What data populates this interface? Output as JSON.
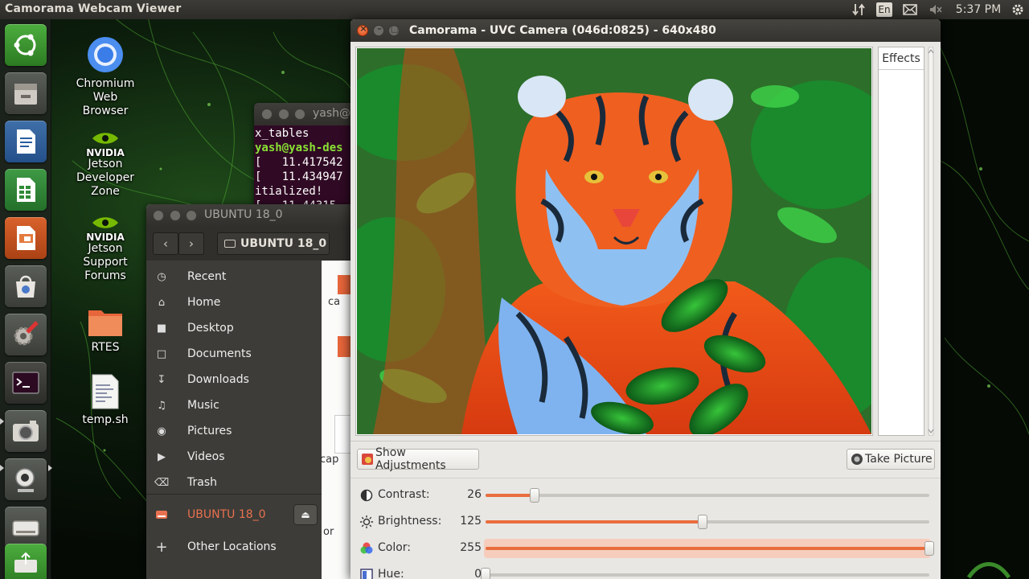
{
  "top_panel": {
    "app_title": "Camorama Webcam Viewer",
    "keyboard_layout": "En",
    "clock": "5:37 PM"
  },
  "launcher": {
    "items": [
      "ubuntu-icon",
      "file-manager-icon",
      "writer-icon",
      "calc-icon",
      "impress-icon",
      "software-center-icon",
      "settings-icon",
      "terminal-icon",
      "camera-icon",
      "webcam-icon",
      "drive-icon",
      "usb-drive-icon"
    ]
  },
  "desktop": {
    "icons": [
      {
        "label": "Chromium\nWeb\nBrowser"
      },
      {
        "label": "Jetson\nDeveloper\nZone",
        "logo": "NVIDIA"
      },
      {
        "label": "Jetson\nSupport\nForums",
        "logo": "NVIDIA"
      },
      {
        "label": "RTES"
      },
      {
        "label": "temp.sh"
      }
    ]
  },
  "terminal": {
    "title": "yash@",
    "lines": [
      "x_tables",
      "yash@yash-des",
      "[   11.417542",
      "[   11.434947",
      "itialized!",
      "[   11.44315"
    ]
  },
  "files": {
    "title": "UBUNTU 18_0",
    "location": "UBUNTU 18_0",
    "sidebar": [
      {
        "label": "Recent",
        "icon": "clock-icon"
      },
      {
        "label": "Home",
        "icon": "home-icon"
      },
      {
        "label": "Desktop",
        "icon": "folder-icon"
      },
      {
        "label": "Documents",
        "icon": "document-icon"
      },
      {
        "label": "Downloads",
        "icon": "download-icon"
      },
      {
        "label": "Music",
        "icon": "music-icon"
      },
      {
        "label": "Pictures",
        "icon": "camera-icon"
      },
      {
        "label": "Videos",
        "icon": "video-icon"
      },
      {
        "label": "Trash",
        "icon": "trash-icon"
      }
    ],
    "mounted": {
      "label": "UBUNTU 18_0",
      "color": "#e9714f"
    },
    "other": {
      "label": "Other Locations"
    },
    "partial_labels": [
      "ca",
      "cap",
      "or"
    ]
  },
  "camorama": {
    "title": "Camorama - UVC Camera (046d:0825) - 640x480",
    "effects_header": "Effects",
    "show_adjustments": "Show Adjustments",
    "take_picture": "Take Picture",
    "adjustments": [
      {
        "label": "Contrast:",
        "value": "26",
        "fraction": 0.11,
        "icon": "contrast-icon"
      },
      {
        "label": "Brightness:",
        "value": "125",
        "fraction": 0.49,
        "icon": "brightness-icon"
      },
      {
        "label": "Color:",
        "value": "255",
        "fraction": 1.0,
        "icon": "color-icon"
      },
      {
        "label": "Hue:",
        "value": "0",
        "fraction": 0.0,
        "icon": "hue-icon"
      }
    ],
    "accent": "#e96e3e"
  }
}
